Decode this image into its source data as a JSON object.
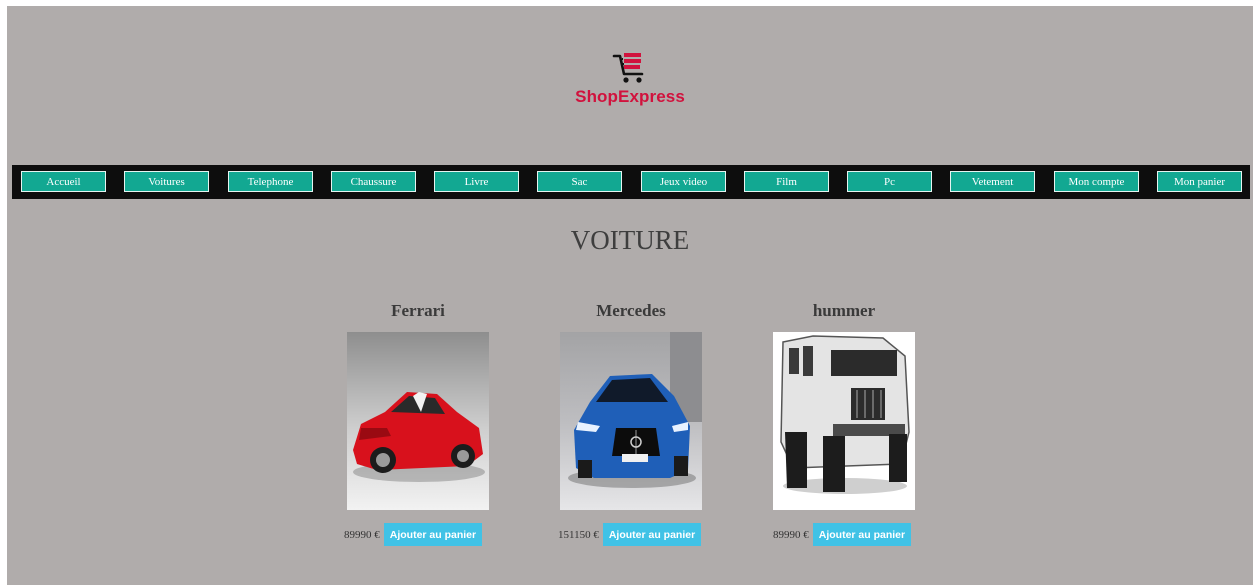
{
  "brand": {
    "name": "ShopExpress",
    "logo_icon": "shopping-cart-icon",
    "color": "#d1123d"
  },
  "nav": {
    "items": [
      "Accueil",
      "Voitures",
      "Telephone",
      "Chaussure",
      "Livre",
      "Sac",
      "Jeux video",
      "Film",
      "Pc",
      "Vetement",
      "Mon compte",
      "Mon panier"
    ],
    "button_color": "#12a892"
  },
  "section_title": "VOITURE",
  "products": [
    {
      "name": "Ferrari",
      "price": "89990 €",
      "button": "Ajouter au panier",
      "image": "red-ferrari-car"
    },
    {
      "name": "Mercedes",
      "price": "151150 €",
      "button": "Ajouter au panier",
      "image": "blue-mercedes-car"
    },
    {
      "name": "hummer",
      "price": "89990 €",
      "button": "Ajouter au panier",
      "image": "white-hummer-truck"
    }
  ],
  "colors": {
    "page_background": "#b0acab",
    "nav_background": "#0d0d0d",
    "add_button": "#40c2e6"
  }
}
